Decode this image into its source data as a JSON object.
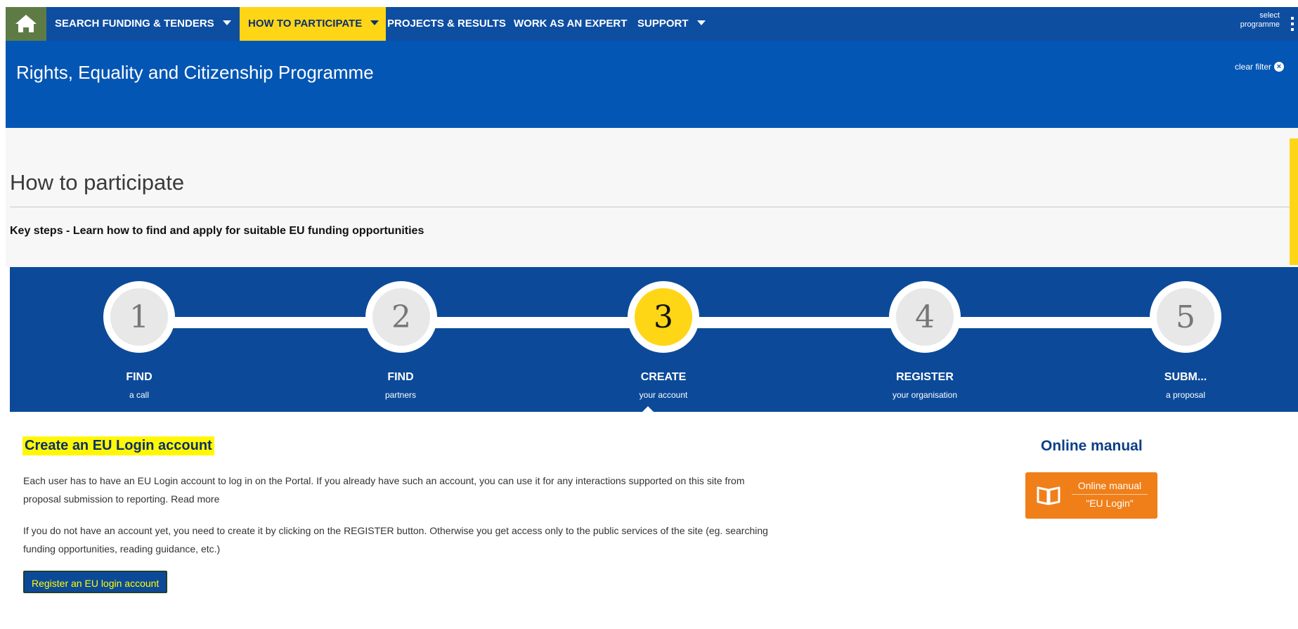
{
  "nav": {
    "home_icon": "home-icon",
    "items": [
      {
        "label": "SEARCH FUNDING & TENDERS",
        "dropdown": true
      },
      {
        "label": "HOW TO PARTICIPATE",
        "dropdown": true,
        "active": true
      },
      {
        "label": "PROJECTS & RESULTS",
        "dropdown": false
      },
      {
        "label": "WORK AS AN EXPERT",
        "dropdown": false
      },
      {
        "label": "SUPPORT",
        "dropdown": true
      }
    ],
    "select_programme_line1": "select",
    "select_programme_line2": "programme",
    "menu_icon": "kebab-menu-icon"
  },
  "header": {
    "programme_title": "Rights, Equality and Citizenship Programme",
    "clear_filter": "clear filter"
  },
  "page": {
    "title": "How to participate",
    "subtitle": "Key steps - Learn how to find and apply for suitable EU funding opportunities"
  },
  "steps": [
    {
      "number": "1",
      "title": "FIND",
      "subtitle": "a call"
    },
    {
      "number": "2",
      "title": "FIND",
      "subtitle": "partners"
    },
    {
      "number": "3",
      "title": "CREATE",
      "subtitle": "your account",
      "current": true
    },
    {
      "number": "4",
      "title": "REGISTER",
      "subtitle": "your organisation"
    },
    {
      "number": "5",
      "title": "SUBM...",
      "subtitle": "a proposal"
    }
  ],
  "content": {
    "heading": "Create an EU Login account",
    "para1_line1": "Each user has to have an EU Login account to log in on the Portal. If you already have such an account, you can use it for any interactions supported on this site from",
    "para1_line2": "proposal submission to reporting. Read more",
    "para2_line1": "If you do not have an account yet, you need to create it by clicking on the REGISTER button. Otherwise you get access only to the public services of the site (eg. searching",
    "para2_line2": "funding opportunities, reading guidance, etc.)",
    "register_button": "Register an EU login account"
  },
  "manual": {
    "heading": "Online manual",
    "button_line1": "Online manual",
    "button_line2": "\"EU Login\"",
    "icon": "book-icon"
  },
  "colors": {
    "nav_bg": "#0e4ea1",
    "header_bg": "#0356b4",
    "steps_bg": "#0c4a99",
    "accent_yellow": "#ffd616",
    "manual_orange": "#f07f19"
  }
}
